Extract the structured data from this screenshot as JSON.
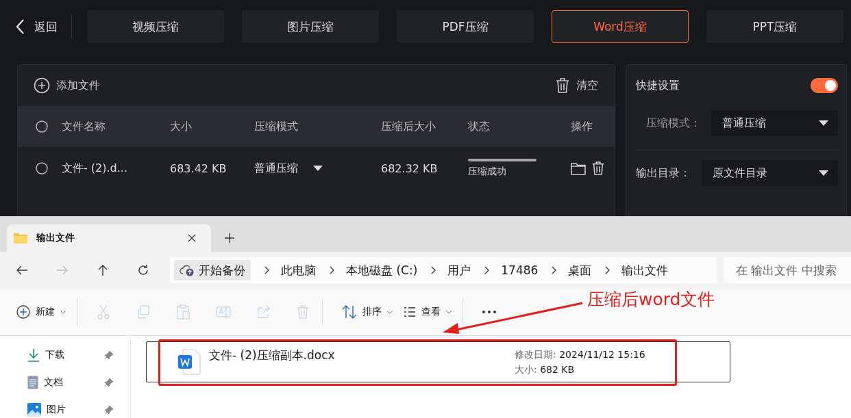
{
  "app": {
    "back": "返回",
    "tabs": [
      {
        "label": "视频压缩",
        "selected": false
      },
      {
        "label": "图片压缩",
        "selected": false
      },
      {
        "label": "PDF压缩",
        "selected": false
      },
      {
        "label": "Word压缩",
        "selected": true
      },
      {
        "label": "PPT压缩",
        "selected": false
      }
    ],
    "file_panel": {
      "add_button": "添加文件",
      "clear_button": "清空",
      "columns": [
        "文件名称",
        "大小",
        "压缩模式",
        "压缩后大小",
        "状态",
        "操作"
      ],
      "rows": [
        {
          "checked": false,
          "name": "文件- (2).d...",
          "size": "683.42 KB",
          "mode": "普通压缩",
          "compressed_size": "682.32 KB",
          "level": 1,
          "status": "压缩成功"
        }
      ]
    },
    "settings": {
      "title": "快捷设置",
      "on": true,
      "mode_label": "压缩模式：",
      "mode_value": "普通压缩",
      "output_label": "输出目录：",
      "output_value": "原文件目录"
    }
  },
  "explorer": {
    "tab_title": "输出文件",
    "nav_buttons": [
      {
        "kind": "back",
        "disabled": false
      },
      {
        "kind": "forward",
        "disabled": true
      },
      {
        "kind": "up",
        "disabled": false
      },
      {
        "kind": "refresh",
        "disabled": false
      }
    ],
    "breadcrumb": [
      "开始备份",
      "此电脑",
      "本地磁盘 (C:)",
      "用户",
      "17486",
      "桌面",
      "输出文件"
    ],
    "search": {
      "placeholder": "在 输出文件 中搜索"
    },
    "toolbar": [
      {
        "kind": "new",
        "label": "新建",
        "disabled": false
      },
      {
        "kind": "cut",
        "disabled": true
      },
      {
        "kind": "copy",
        "disabled": true
      },
      {
        "kind": "paste",
        "disabled": true
      },
      {
        "kind": "rename",
        "disabled": true
      },
      {
        "kind": "share",
        "disabled": true
      },
      {
        "kind": "delete",
        "disabled": true
      },
      {
        "kind": "sort",
        "label": "排序",
        "disabled": false
      },
      {
        "kind": "view",
        "label": "查看",
        "disabled": false
      },
      {
        "kind": "more",
        "disabled": false
      }
    ],
    "sidebar": [
      {
        "kind": "download",
        "label": "下载",
        "pinned": true
      },
      {
        "kind": "document",
        "label": "文档",
        "pinned": true
      },
      {
        "kind": "picture",
        "label": "图片",
        "pinned": true
      }
    ],
    "files": [
      {
        "name": "文件- (2)压缩副本.docx",
        "date_label": "修改日期:",
        "date": "2024/11/12 15:16",
        "size_label": "大小:",
        "size": "682 KB"
      }
    ]
  },
  "annotation": {
    "text": "压缩后word文件"
  }
}
